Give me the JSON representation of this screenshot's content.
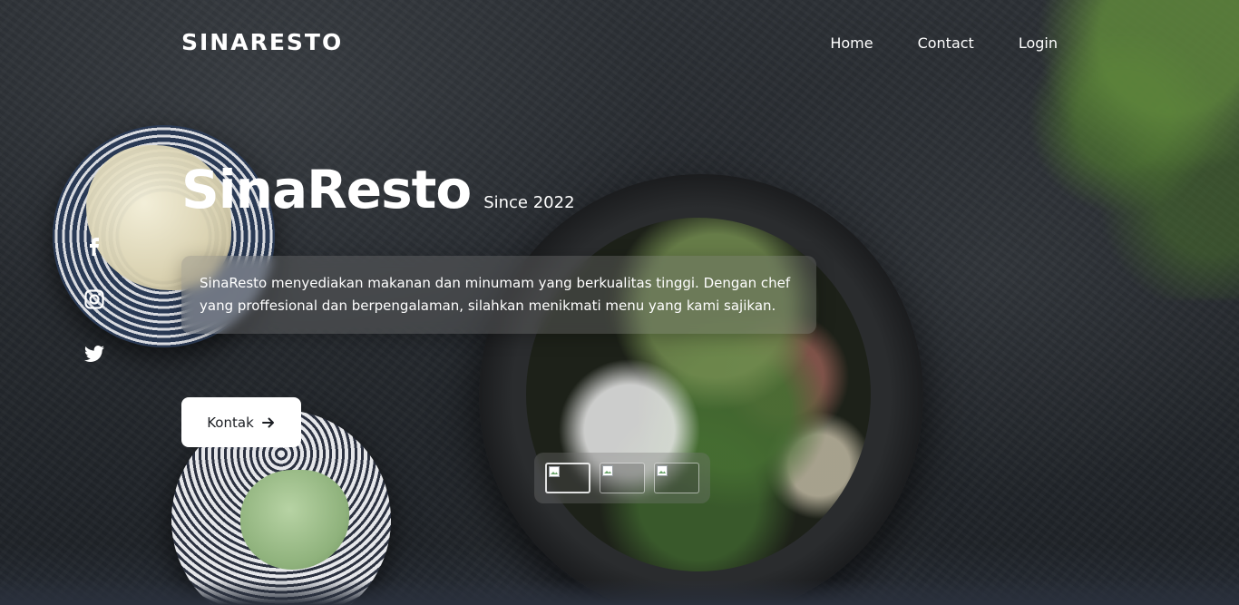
{
  "nav": {
    "brand": "SINARESTO",
    "links": [
      "Home",
      "Contact",
      "Login"
    ]
  },
  "social": {
    "items": [
      "facebook-icon",
      "instagram-icon",
      "twitter-icon"
    ]
  },
  "hero": {
    "title": "SinaResto",
    "since": "Since 2022",
    "description": "SinaResto menyediakan makanan dan minumam yang berkualitas tinggi. Dengan chef yang proffesional dan berpengalaman, silahkan menikmati menu yang kami sajikan.",
    "cta_label": "Kontak"
  },
  "thumbnails": {
    "count": 3,
    "active_index": 0,
    "icon": "broken-image-icon"
  },
  "colors": {
    "background": "#25292e",
    "text": "#ffffff",
    "button_bg": "#ffffff",
    "button_text": "#1b1e23",
    "glass_panel": "rgba(120,120,120,0.35)"
  }
}
